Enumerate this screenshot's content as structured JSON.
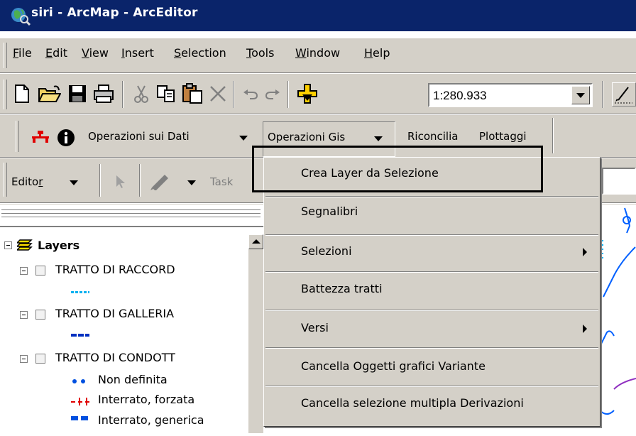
{
  "window": {
    "title": "siri - ArcMap - ArcEditor"
  },
  "menubar": {
    "items": [
      {
        "key": "F",
        "rest": "ile"
      },
      {
        "key": "E",
        "rest": "dit"
      },
      {
        "key": "V",
        "rest": "iew"
      },
      {
        "key": "I",
        "rest": "nsert"
      },
      {
        "key": "S",
        "rest": "election"
      },
      {
        "key": "T",
        "rest": "ools"
      },
      {
        "key": "W",
        "rest": "indow"
      },
      {
        "key": "H",
        "rest": "elp"
      }
    ]
  },
  "standard_toolbar": {
    "icons": [
      "new-icon",
      "open-icon",
      "save-icon",
      "print-icon",
      "cut-icon",
      "copy-icon",
      "paste-icon",
      "delete-icon",
      "undo-icon",
      "redo-icon",
      "add-data-icon",
      "editor-toolbar-icon"
    ],
    "scale": "1:280.933"
  },
  "custom_toolbar": {
    "operazioni_dati": "Operazioni sui Dati",
    "operazioni_gis": "Operazioni Gis",
    "riconcilia": "Riconcilia",
    "plottaggi": "Plottaggi"
  },
  "editor_toolbar": {
    "editor_key": "r",
    "editor_pre": "Edito",
    "task_label": "Task"
  },
  "toc": {
    "root": "Layers",
    "layers": [
      {
        "name": "TRATTO DI RACCORD"
      },
      {
        "name": "TRATTO DI GALLERIA"
      },
      {
        "name": "TRATTO DI CONDOTT"
      }
    ],
    "legend": [
      "Non definita",
      "Interrato, forzata",
      "Interrato, generica"
    ]
  },
  "dropdown_menu": {
    "items": [
      {
        "label": "Crea Layer da Selezione",
        "submenu": false
      },
      {
        "label": "Segnalibri",
        "submenu": false
      },
      {
        "label": "Selezioni",
        "submenu": true
      },
      {
        "label": "Battezza tratti",
        "submenu": false
      },
      {
        "label": "Versi",
        "submenu": true
      },
      {
        "label": "Cancella Oggetti grafici Variante",
        "submenu": false
      },
      {
        "label": "Cancella selezione multipla Derivazioni",
        "submenu": false
      }
    ]
  },
  "colors": {
    "titlebar": "#0a246a",
    "chrome": "#d4d0c8",
    "callout": "#000000"
  }
}
